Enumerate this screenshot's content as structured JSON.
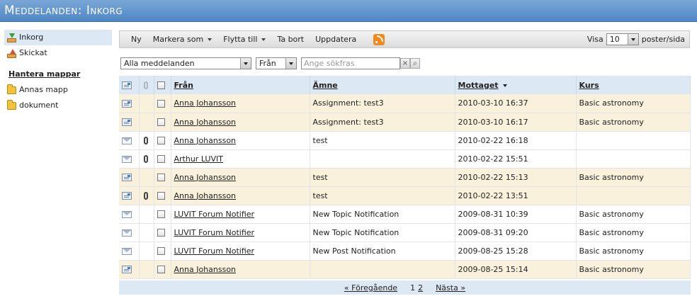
{
  "title": "Meddelanden: Inkorg",
  "sidebar": {
    "items": [
      {
        "label": "Inkorg",
        "icon": "inbox-icon"
      },
      {
        "label": "Skickat",
        "icon": "sent-icon"
      }
    ],
    "manage_folders": "Hantera mappar",
    "folders": [
      {
        "label": "Annas mapp",
        "icon": "folder-icon"
      },
      {
        "label": "dokument",
        "icon": "folder-icon"
      }
    ]
  },
  "toolbar": {
    "new": "Ny",
    "mark_as": "Markera som",
    "move_to": "Flytta till",
    "delete": "Ta bort",
    "refresh": "Uppdatera",
    "show_label": "Visa",
    "per_page_value": "10",
    "per_page_suffix": "poster/sida"
  },
  "filters": {
    "message_filter": "Alla meddelanden",
    "field_filter": "Från",
    "search_placeholder": "Ange sökfras"
  },
  "table": {
    "headers": {
      "from": "Från",
      "subject": "Ämne",
      "received": "Mottaget",
      "course": "Kurs"
    },
    "rows": [
      {
        "unread": true,
        "attachment": false,
        "from": "Anna Johansson",
        "subject": "Assignment: test3",
        "received": "2010-03-10 16:37",
        "course": "Basic astronomy"
      },
      {
        "unread": true,
        "attachment": false,
        "from": "Anna Johansson",
        "subject": "Assignment: test3",
        "received": "2010-03-10 16:17",
        "course": "Basic astronomy"
      },
      {
        "unread": false,
        "attachment": true,
        "from": "Anna Johansson",
        "subject": "test",
        "received": "2010-02-22 16:18",
        "course": ""
      },
      {
        "unread": false,
        "attachment": true,
        "from": "Arthur LUVIT",
        "subject": "",
        "received": "2010-02-22 15:51",
        "course": ""
      },
      {
        "unread": true,
        "attachment": false,
        "from": "Anna Johansson",
        "subject": "test",
        "received": "2010-02-22 15:13",
        "course": "Basic astronomy"
      },
      {
        "unread": true,
        "attachment": true,
        "from": "Anna Johansson",
        "subject": "test",
        "received": "2010-02-22 13:51",
        "course": ""
      },
      {
        "unread": false,
        "attachment": false,
        "from": "LUVIT Forum Notifier",
        "subject": "New Topic Notification",
        "received": "2009-08-31 10:39",
        "course": "Basic astronomy"
      },
      {
        "unread": false,
        "attachment": false,
        "from": "LUVIT Forum Notifier",
        "subject": "New Topic Notification",
        "received": "2009-08-31 09:20",
        "course": "Basic astronomy"
      },
      {
        "unread": false,
        "attachment": false,
        "from": "LUVIT Forum Notifier",
        "subject": "New Post Notification",
        "received": "2009-08-25 15:28",
        "course": "Basic astronomy"
      },
      {
        "unread": true,
        "attachment": false,
        "from": "Anna Johansson",
        "subject": "",
        "received": "2009-08-25 15:14",
        "course": "Basic astronomy"
      }
    ]
  },
  "pager": {
    "prev": "« Föregående",
    "current": "1",
    "page2": "2",
    "next": "Nästa »"
  }
}
